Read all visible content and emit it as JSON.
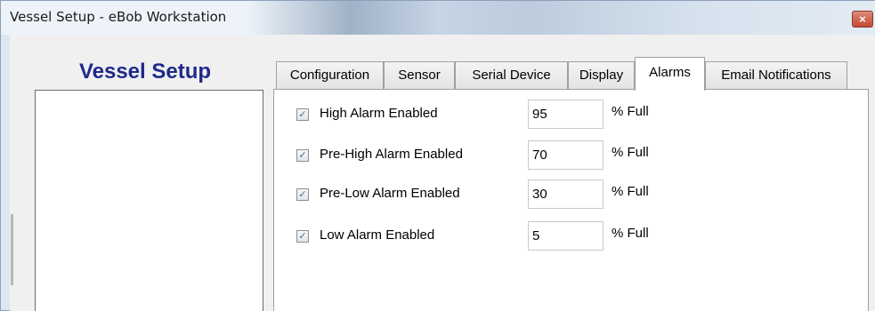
{
  "window": {
    "title": "Vessel Setup - eBob Workstation",
    "close_glyph": "×"
  },
  "sidebar": {
    "title": "Vessel Setup"
  },
  "tabs": [
    {
      "label": "Configuration",
      "active": false
    },
    {
      "label": "Sensor",
      "active": false
    },
    {
      "label": "Serial Device",
      "active": false
    },
    {
      "label": "Display",
      "active": false
    },
    {
      "label": "Alarms",
      "active": true
    },
    {
      "label": "Email Notifications",
      "active": false
    }
  ],
  "alarms": [
    {
      "label": "High Alarm Enabled",
      "checked": true,
      "value": "95",
      "unit": "% Full"
    },
    {
      "label": "Pre-High Alarm Enabled",
      "checked": true,
      "value": "70",
      "unit": "% Full"
    },
    {
      "label": "Pre-Low Alarm Enabled",
      "checked": true,
      "value": "30",
      "unit": "% Full"
    },
    {
      "label": "Low Alarm Enabled",
      "checked": true,
      "value": "5",
      "unit": "% Full"
    }
  ],
  "colors": {
    "sidebar_title": "#1f2a8a",
    "close_button": "#c24a33"
  }
}
